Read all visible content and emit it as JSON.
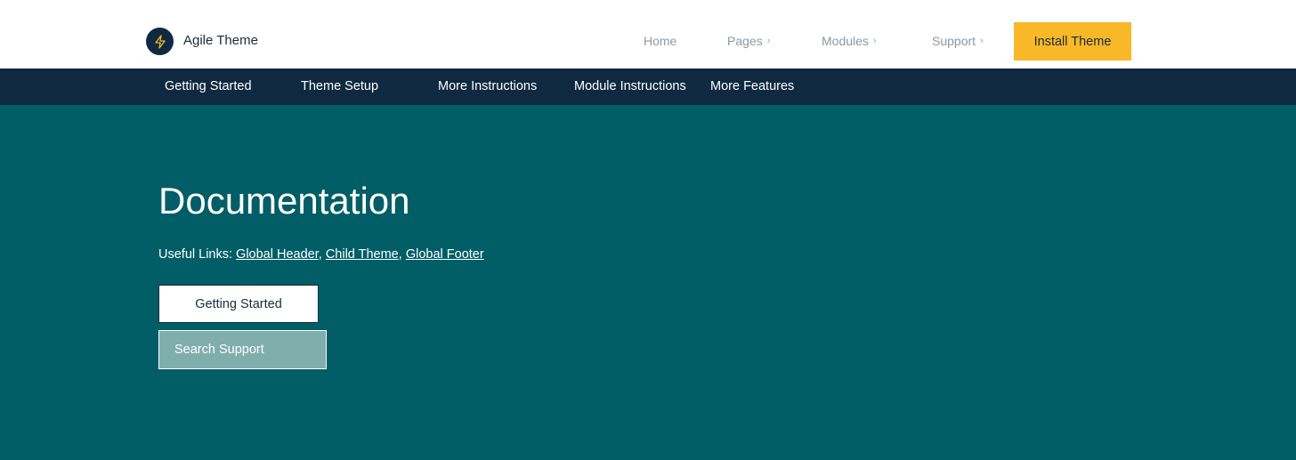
{
  "header": {
    "brand": "Agile Theme",
    "nav": [
      {
        "label": "Home",
        "has_chevron": false
      },
      {
        "label": "Pages",
        "has_chevron": true
      },
      {
        "label": "Modules",
        "has_chevron": true
      },
      {
        "label": "Support",
        "has_chevron": true
      }
    ],
    "cta": "Install Theme",
    "logo_icon": "lightning-bolt-icon",
    "chevron_icon": "chevron-right-icon"
  },
  "subnav": {
    "items": [
      "Getting Started",
      "Theme Setup",
      "More Instructions",
      "Module Instructions",
      "More Features"
    ]
  },
  "hero": {
    "title": "Documentation",
    "links_label": "Useful Links:",
    "links": [
      "Global Header",
      "Child Theme",
      "Global Footer"
    ],
    "primary_button": "Getting Started",
    "secondary_button": "Search Support"
  },
  "colors": {
    "hero_bg": "#025e66",
    "subnav_bg": "#0f2a40",
    "accent": "#f8b828"
  }
}
